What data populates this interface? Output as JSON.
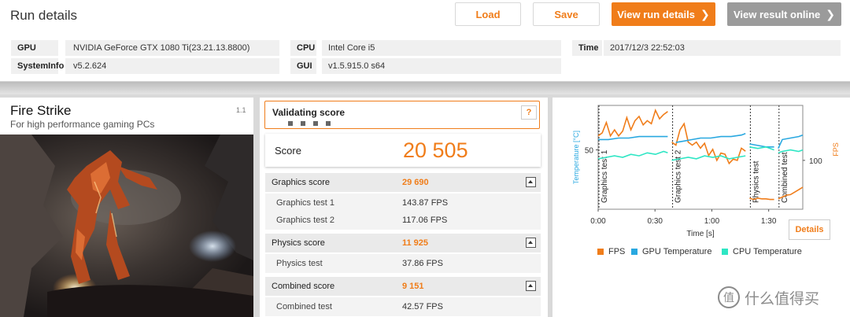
{
  "header": {
    "title": "Run details",
    "buttons": {
      "load": "Load",
      "save": "Save",
      "view_run": "View run details",
      "view_online": "View result online"
    }
  },
  "system_info": {
    "gpu_label": "GPU",
    "gpu_value": "NVIDIA GeForce GTX 1080 Ti(23.21.13.8800)",
    "systeminfo_label": "SystemInfo",
    "systeminfo_value": "v5.2.624",
    "cpu_label": "CPU",
    "cpu_value": "Intel Core i5",
    "gui_label": "GUI",
    "gui_value": "v1.5.915.0 s64",
    "time_label": "Time",
    "time_value": "2017/12/3 22:52:03"
  },
  "benchmark": {
    "name": "Fire Strike",
    "subtitle": "For high performance gaming PCs",
    "version": "1.1"
  },
  "validation": {
    "label": "Validating score",
    "help": "?"
  },
  "score": {
    "label": "Score",
    "value": "20 505"
  },
  "results": {
    "graphics_label": "Graphics score",
    "graphics_value": "29 690",
    "gt1_label": "Graphics test 1",
    "gt1_value": "143.87 FPS",
    "gt2_label": "Graphics test 2",
    "gt2_value": "117.06 FPS",
    "physics_label": "Physics score",
    "physics_value": "11 925",
    "pt_label": "Physics test",
    "pt_value": "37.86 FPS",
    "combined_label": "Combined score",
    "combined_value": "9 151",
    "ct_label": "Combined test",
    "ct_value": "42.57 FPS"
  },
  "chart_data": {
    "type": "line",
    "xlabel": "Time [s]",
    "ylabel_left": "Temperature [°C]",
    "ylabel_right": "FPS",
    "x_ticks": [
      "0:00",
      "0:30",
      "1:00",
      "1:30"
    ],
    "y_left_ticks": [
      "50"
    ],
    "y_right_ticks": [
      "100"
    ],
    "sections": [
      "Graphics test 1",
      "Graphics test 2",
      "Physics test",
      "Combined test"
    ],
    "legend": [
      "FPS",
      "GPU Temperature",
      "CPU Temperature"
    ],
    "colors": {
      "fps": "#f07d1a",
      "gpu": "#29a8e0",
      "cpu": "#2ee6c4"
    },
    "series": [
      {
        "name": "FPS",
        "values": [
          [
            0,
            140
          ],
          [
            2,
            145
          ],
          [
            4,
            162
          ],
          [
            6,
            140
          ],
          [
            8,
            150
          ],
          [
            10,
            140
          ],
          [
            12,
            148
          ],
          [
            14,
            170
          ],
          [
            16,
            150
          ],
          [
            18,
            165
          ],
          [
            20,
            172
          ],
          [
            22,
            158
          ],
          [
            24,
            165
          ],
          [
            26,
            160
          ],
          [
            28,
            182
          ],
          [
            30,
            168
          ],
          [
            32,
            175
          ],
          [
            34,
            180
          ],
          [
            36,
            130
          ],
          [
            38,
            125
          ],
          [
            40,
            150
          ],
          [
            42,
            160
          ],
          [
            44,
            130
          ],
          [
            46,
            125
          ],
          [
            48,
            130
          ],
          [
            50,
            120
          ],
          [
            52,
            128
          ],
          [
            54,
            108
          ],
          [
            56,
            118
          ],
          [
            58,
            100
          ],
          [
            60,
            112
          ],
          [
            62,
            110
          ],
          [
            64,
            95
          ],
          [
            66,
            102
          ],
          [
            68,
            100
          ],
          [
            70,
            120
          ],
          [
            72,
            115
          ],
          [
            74,
            38
          ],
          [
            76,
            36
          ],
          [
            78,
            38
          ],
          [
            80,
            37
          ],
          [
            82,
            37
          ],
          [
            84,
            36
          ],
          [
            86,
            36
          ],
          [
            88,
            37
          ],
          [
            90,
            40
          ],
          [
            92,
            43
          ],
          [
            94,
            44
          ],
          [
            96,
            48
          ],
          [
            98,
            52
          ],
          [
            100,
            56
          ]
        ]
      },
      {
        "name": "GPU Temperature",
        "values": [
          [
            0,
            57
          ],
          [
            5,
            57
          ],
          [
            10,
            58
          ],
          [
            15,
            58
          ],
          [
            20,
            59
          ],
          [
            25,
            59
          ],
          [
            30,
            59
          ],
          [
            34,
            59
          ],
          [
            38,
            55
          ],
          [
            42,
            56
          ],
          [
            46,
            57
          ],
          [
            50,
            58
          ],
          [
            55,
            58
          ],
          [
            60,
            59
          ],
          [
            65,
            59
          ],
          [
            70,
            60
          ],
          [
            72,
            61
          ],
          [
            74,
            54
          ],
          [
            78,
            53
          ],
          [
            82,
            52
          ],
          [
            86,
            52
          ],
          [
            88,
            51
          ],
          [
            90,
            57
          ],
          [
            94,
            58
          ],
          [
            98,
            59
          ],
          [
            100,
            60
          ]
        ]
      },
      {
        "name": "CPU Temperature",
        "values": [
          [
            0,
            44
          ],
          [
            4,
            45
          ],
          [
            8,
            46
          ],
          [
            12,
            45
          ],
          [
            16,
            47
          ],
          [
            20,
            46
          ],
          [
            24,
            48
          ],
          [
            28,
            47
          ],
          [
            32,
            49
          ],
          [
            34,
            48
          ],
          [
            36,
            43
          ],
          [
            40,
            44
          ],
          [
            44,
            45
          ],
          [
            48,
            44
          ],
          [
            52,
            46
          ],
          [
            56,
            45
          ],
          [
            60,
            46
          ],
          [
            64,
            44
          ],
          [
            68,
            45
          ],
          [
            72,
            46
          ],
          [
            74,
            52
          ],
          [
            78,
            51
          ],
          [
            82,
            52
          ],
          [
            86,
            50
          ],
          [
            88,
            48
          ],
          [
            90,
            49
          ],
          [
            94,
            50
          ],
          [
            98,
            49
          ],
          [
            100,
            50
          ]
        ]
      }
    ]
  },
  "chart_controls": {
    "details": "Details"
  },
  "watermark": {
    "text": "什么值得买"
  }
}
